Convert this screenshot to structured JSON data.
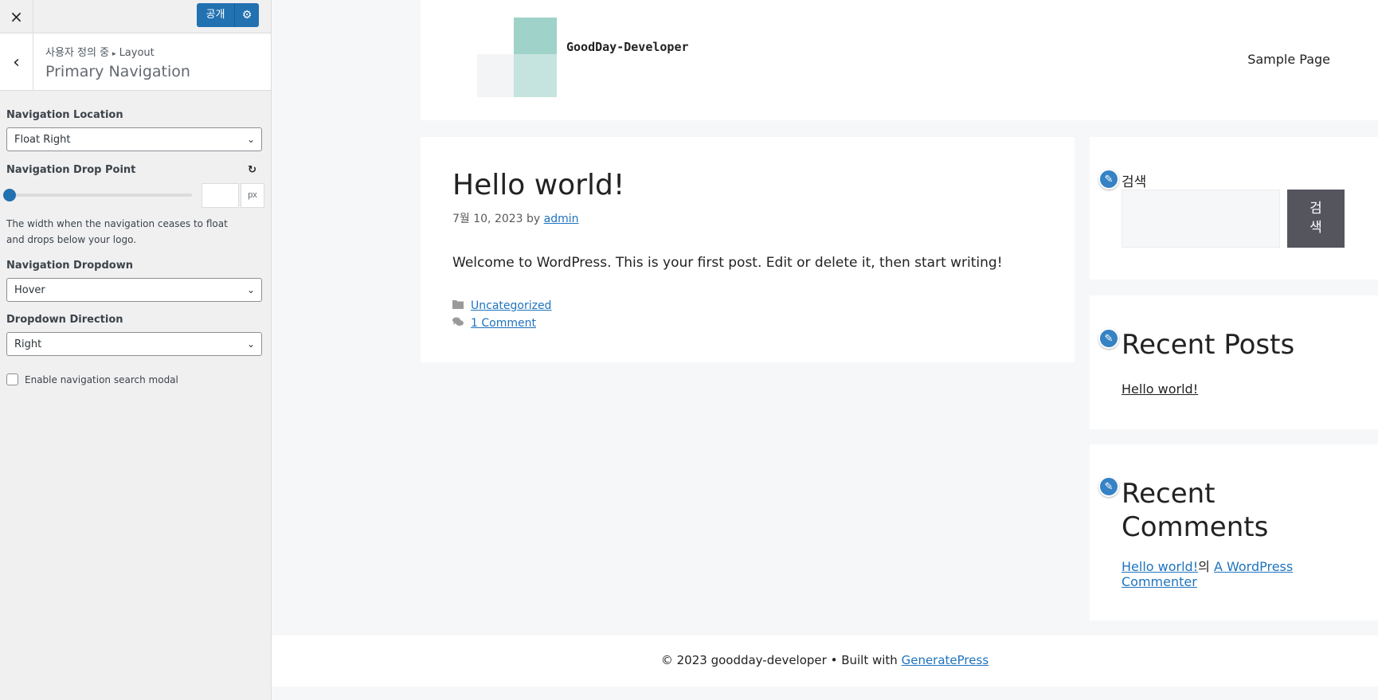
{
  "customizer": {
    "close_icon": "×",
    "publish_label": "공개",
    "gear_icon": "⚙",
    "back_icon": "‹",
    "breadcrumb_parent": "사용자 정의 중",
    "breadcrumb_sep": "▸",
    "breadcrumb_child": "Layout",
    "section_title": "Primary Navigation",
    "controls": {
      "nav_location": {
        "label": "Navigation Location",
        "value": "Float Right"
      },
      "drop_point": {
        "label": "Navigation Drop Point",
        "unit": "px",
        "value": "",
        "slider_fraction": 0,
        "description": "The width when the navigation ceases to float and drops below your logo."
      },
      "nav_dropdown": {
        "label": "Navigation Dropdown",
        "value": "Hover"
      },
      "dropdown_direction": {
        "label": "Dropdown Direction",
        "value": "Right"
      },
      "search_modal": {
        "label": "Enable navigation search modal",
        "checked": false
      }
    }
  },
  "site": {
    "title": "GoodDay-Developer",
    "nav_item": "Sample Page",
    "logo_colors": [
      "#9fd2c9",
      "#f3f4f5",
      "#c6e4df"
    ]
  },
  "post": {
    "title": "Hello world!",
    "date": "7월 10, 2023",
    "by": "by",
    "author": "admin",
    "body": "Welcome to WordPress. This is your first post. Edit or delete it, then start writing!",
    "category": "Uncategorized",
    "comments": "1 Comment"
  },
  "widgets": {
    "search": {
      "label": "검색",
      "button_line1": "검",
      "button_line2": "색"
    },
    "recent_posts": {
      "title": "Recent Posts",
      "item": "Hello world!"
    },
    "recent_comments": {
      "title": "Recent Comments",
      "post_link": "Hello world!",
      "connector": "의",
      "author_link": "A WordPress Commenter"
    }
  },
  "footer": {
    "text": "© 2023 goodday-developer • Built with",
    "link": "GeneratePress"
  },
  "colors": {
    "accent": "#2271b1",
    "link": "#1e73be",
    "edit_badge": "#3582c4",
    "search_button": "#55555e"
  }
}
